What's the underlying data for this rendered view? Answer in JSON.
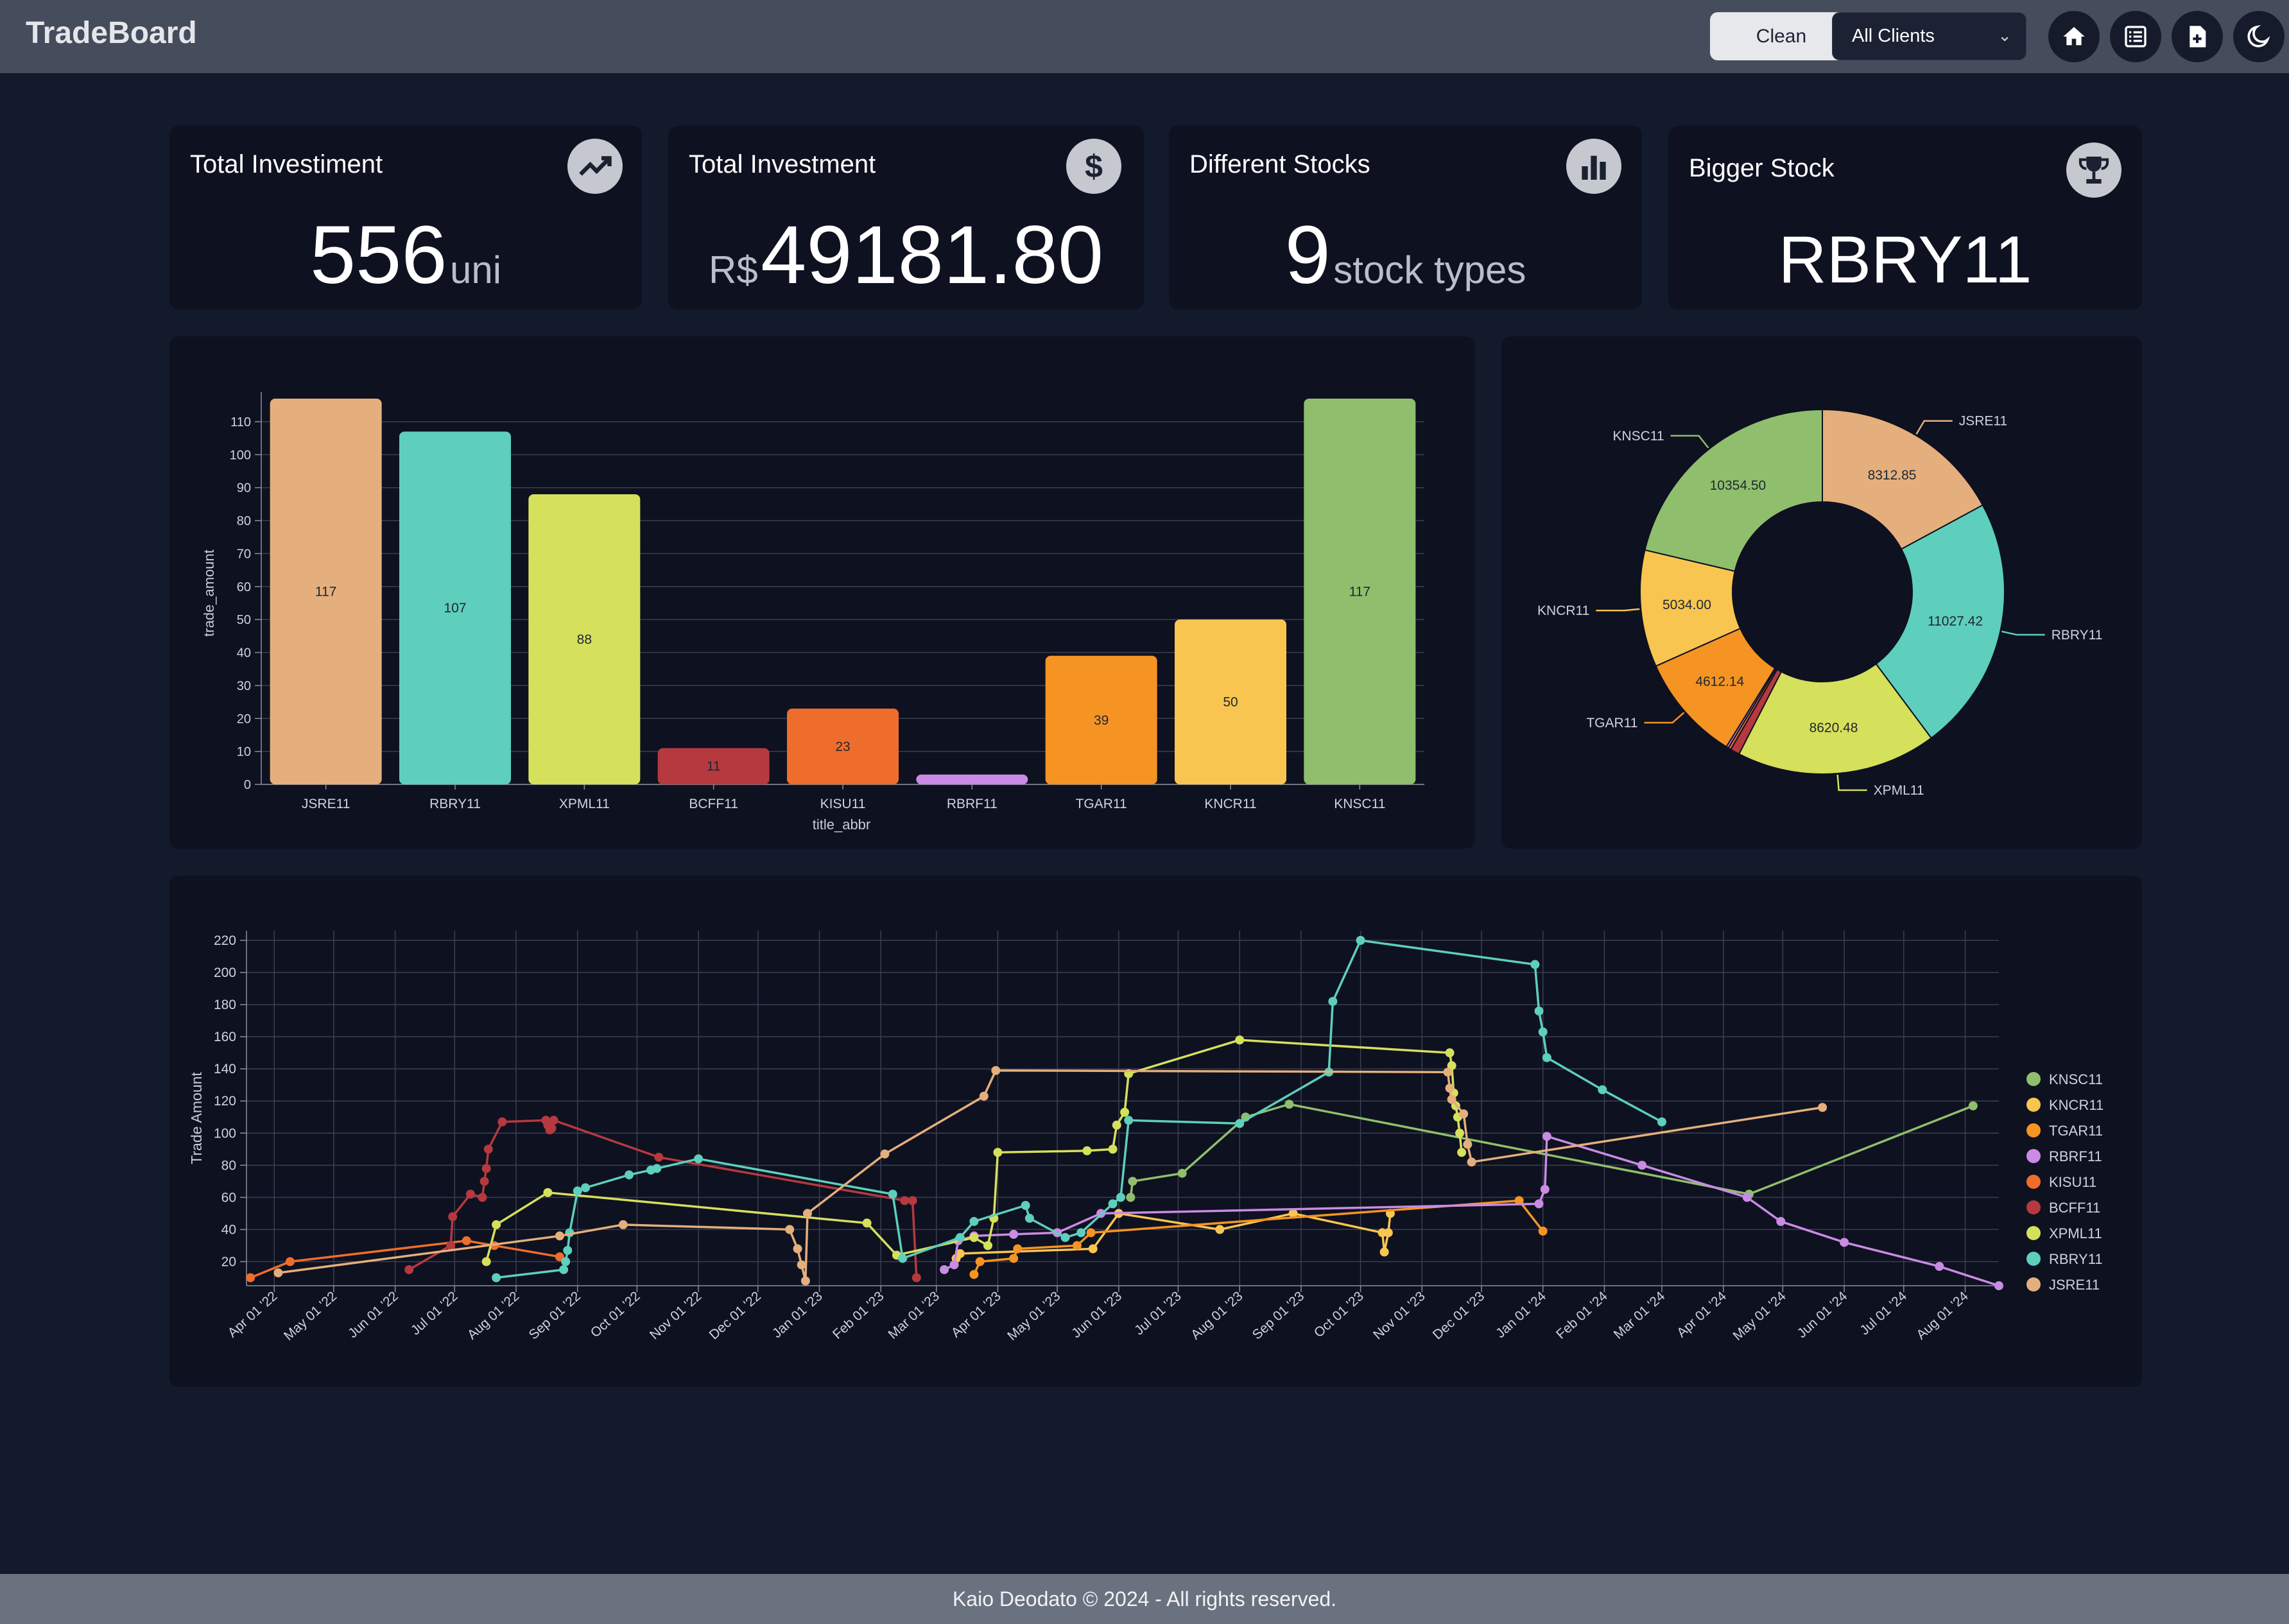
{
  "app": {
    "title": "TradeBoard"
  },
  "toolbar": {
    "clean_label": "Clean",
    "client_filter": "All Clients",
    "icons": [
      "home-icon",
      "list-icon",
      "add-file-icon",
      "moon-icon"
    ]
  },
  "kpis": [
    {
      "title": "Total Investiment",
      "prefix": "",
      "value": "556",
      "unit": "uni",
      "icon": "trend-icon"
    },
    {
      "title": "Total Investment",
      "prefix": "R$",
      "value": "49181.80",
      "unit": "",
      "icon": "dollar-icon"
    },
    {
      "title": "Different Stocks",
      "prefix": "",
      "value": "9",
      "unit": "stock types",
      "icon": "bar-chart-icon"
    },
    {
      "title": "Bigger Stock",
      "prefix": "",
      "value": "RBRY11",
      "unit": "",
      "icon": "trophy-icon"
    }
  ],
  "chart_data": [
    {
      "type": "bar",
      "xlabel": "title_abbr",
      "ylabel": "trade_amount",
      "ylim": [
        0,
        117
      ],
      "yticks": [
        0,
        10,
        20,
        30,
        40,
        50,
        60,
        70,
        80,
        90,
        100,
        110
      ],
      "categories": [
        "JSRE11",
        "RBRY11",
        "XPML11",
        "BCFF11",
        "KISU11",
        "RBRF11",
        "TGAR11",
        "KNCR11",
        "KNSC11"
      ],
      "values": [
        117,
        107,
        88,
        11,
        23,
        3,
        39,
        50,
        117
      ],
      "data_labels": [
        "117",
        "107",
        "88",
        "11",
        "23",
        "",
        "39",
        "50",
        "117"
      ],
      "colors": [
        "#e4af7c",
        "#5dcfbc",
        "#d5e05b",
        "#b5393f",
        "#ef6d2c",
        "#c98be4",
        "#f59423",
        "#f8c551",
        "#8fbf6c"
      ],
      "grid": true
    },
    {
      "type": "pie",
      "subtype": "donut",
      "slices": [
        {
          "label": "JSRE11",
          "value": 8312.85,
          "value_label": "8312.85",
          "color": "#e4af7c"
        },
        {
          "label": "RBRY11",
          "value": 11027.42,
          "value_label": "11027.42",
          "color": "#5dcfbc"
        },
        {
          "label": "XPML11",
          "value": 8620.48,
          "value_label": "8620.48",
          "color": "#d5e05b"
        },
        {
          "label": "BCFF11",
          "value": 400,
          "value_label": "",
          "color": "#b5393f"
        },
        {
          "label": "KISU11",
          "value": 120,
          "value_label": "",
          "color": "#ef6d2c"
        },
        {
          "label": "RBRF11",
          "value": 100,
          "value_label": "",
          "color": "#c98be4"
        },
        {
          "label": "TGAR11",
          "value": 4612.14,
          "value_label": "4612.14",
          "color": "#f59423"
        },
        {
          "label": "KNCR11",
          "value": 5034.0,
          "value_label": "5034.00",
          "color": "#f8c551"
        },
        {
          "label": "KNSC11",
          "value": 10354.5,
          "value_label": "10354.50",
          "color": "#8fbf6c"
        }
      ],
      "outer_labels": [
        "JSRE11",
        "RBRY11",
        "XPML11",
        "TGAR11",
        "KNCR11",
        "KNSC11"
      ]
    },
    {
      "type": "line",
      "ylabel": "Trade Amount",
      "xlabel": "",
      "ylim": [
        5,
        222
      ],
      "yticks": [
        20,
        40,
        60,
        80,
        100,
        120,
        140,
        160,
        180,
        200,
        220
      ],
      "xlim": [
        "2022-03-18",
        "2024-08-18"
      ],
      "xticks": [
        "Apr 01 '22",
        "May 01 '22",
        "Jun 01 '22",
        "Jul 01 '22",
        "Aug 01 '22",
        "Sep 01 '22",
        "Oct 01 '22",
        "Nov 01 '22",
        "Dec 01 '22",
        "Jan 01 '23",
        "Feb 01 '23",
        "Mar 01 '23",
        "Apr 01 '23",
        "May 01 '23",
        "Jun 01 '23",
        "Jul 01 '23",
        "Aug 01 '23",
        "Sep 01 '23",
        "Oct 01 '23",
        "Nov 01 '23",
        "Dec 01 '23",
        "Jan 01 '24",
        "Feb 01 '24",
        "Mar 01 '24",
        "Apr 01 '24",
        "May 01 '24",
        "Jun 01 '24",
        "Jul 01 '24",
        "Aug 01 '24"
      ],
      "legend_position": "right",
      "grid": true,
      "series": [
        {
          "name": "KNSC11",
          "color": "#8fbf6c",
          "points": [
            [
              "2023-06-07",
              60
            ],
            [
              "2023-06-08",
              70
            ],
            [
              "2023-07-03",
              75
            ],
            [
              "2023-08-04",
              110
            ],
            [
              "2023-08-26",
              118
            ],
            [
              "2024-04-14",
              62
            ],
            [
              "2024-08-05",
              117
            ]
          ]
        },
        {
          "name": "KNCR11",
          "color": "#f8c551",
          "points": [
            [
              "2023-03-11",
              22
            ],
            [
              "2023-03-13",
              25
            ],
            [
              "2023-05-19",
              28
            ],
            [
              "2023-06-01",
              50
            ],
            [
              "2023-07-22",
              40
            ],
            [
              "2023-08-28",
              50
            ],
            [
              "2023-10-12",
              38
            ],
            [
              "2023-10-13",
              26
            ],
            [
              "2023-10-15",
              38
            ],
            [
              "2023-10-16",
              50
            ]
          ]
        },
        {
          "name": "TGAR11",
          "color": "#f59423",
          "points": [
            [
              "2023-03-20",
              12
            ],
            [
              "2023-03-23",
              20
            ],
            [
              "2023-04-09",
              22
            ],
            [
              "2023-04-11",
              28
            ],
            [
              "2023-05-11",
              30
            ],
            [
              "2023-05-18",
              38
            ],
            [
              "2023-12-20",
              58
            ],
            [
              "2024-01-01",
              39
            ]
          ]
        },
        {
          "name": "RBRF11",
          "color": "#c98be4",
          "points": [
            [
              "2023-03-05",
              15
            ],
            [
              "2023-03-10",
              18
            ],
            [
              "2023-03-12",
              33
            ],
            [
              "2023-03-20",
              36
            ],
            [
              "2023-04-09",
              37
            ],
            [
              "2023-05-01",
              38
            ],
            [
              "2023-05-23",
              50
            ],
            [
              "2023-12-30",
              56
            ],
            [
              "2024-01-02",
              65
            ],
            [
              "2024-01-03",
              98
            ],
            [
              "2024-02-20",
              80
            ],
            [
              "2024-04-13",
              60
            ],
            [
              "2024-04-30",
              45
            ],
            [
              "2024-06-01",
              32
            ],
            [
              "2024-07-19",
              17
            ],
            [
              "2024-08-18",
              5
            ]
          ]
        },
        {
          "name": "KISU11",
          "color": "#ef6d2c",
          "points": [
            [
              "2022-03-20",
              10
            ],
            [
              "2022-04-09",
              20
            ],
            [
              "2022-07-07",
              33
            ],
            [
              "2022-07-21",
              30
            ],
            [
              "2022-08-23",
              23
            ]
          ]
        },
        {
          "name": "BCFF11",
          "color": "#b5393f",
          "points": [
            [
              "2022-06-08",
              15
            ],
            [
              "2022-06-29",
              30
            ],
            [
              "2022-06-30",
              48
            ],
            [
              "2022-07-09",
              62
            ],
            [
              "2022-07-15",
              60
            ],
            [
              "2022-07-16",
              70
            ],
            [
              "2022-07-17",
              78
            ],
            [
              "2022-07-18",
              90
            ],
            [
              "2022-07-25",
              107
            ],
            [
              "2022-08-16",
              108
            ],
            [
              "2022-08-17",
              105
            ],
            [
              "2022-08-18",
              102
            ],
            [
              "2022-08-19",
              103
            ],
            [
              "2022-08-20",
              108
            ],
            [
              "2022-10-12",
              85
            ],
            [
              "2023-02-13",
              58
            ],
            [
              "2023-02-17",
              58
            ],
            [
              "2023-02-19",
              10
            ]
          ]
        },
        {
          "name": "XPML11",
          "color": "#d5e05b",
          "points": [
            [
              "2022-07-17",
              20
            ],
            [
              "2022-07-22",
              43
            ],
            [
              "2022-08-17",
              63
            ],
            [
              "2023-01-25",
              44
            ],
            [
              "2023-02-09",
              24
            ],
            [
              "2023-03-20",
              35
            ],
            [
              "2023-03-27",
              30
            ],
            [
              "2023-03-30",
              47
            ],
            [
              "2023-04-01",
              88
            ],
            [
              "2023-05-16",
              89
            ],
            [
              "2023-05-29",
              90
            ],
            [
              "2023-05-31",
              105
            ],
            [
              "2023-06-04",
              113
            ],
            [
              "2023-06-06",
              137
            ],
            [
              "2023-08-01",
              158
            ],
            [
              "2023-11-15",
              150
            ],
            [
              "2023-11-16",
              142
            ],
            [
              "2023-11-17",
              125
            ],
            [
              "2023-11-18",
              117
            ],
            [
              "2023-11-19",
              110
            ],
            [
              "2023-11-20",
              100
            ],
            [
              "2023-11-21",
              88
            ]
          ]
        },
        {
          "name": "RBRY11",
          "color": "#5dcfbc",
          "points": [
            [
              "2022-07-22",
              10
            ],
            [
              "2022-08-25",
              15
            ],
            [
              "2022-08-26",
              20
            ],
            [
              "2022-08-27",
              27
            ],
            [
              "2022-08-28",
              38
            ],
            [
              "2022-09-01",
              64
            ],
            [
              "2022-09-05",
              66
            ],
            [
              "2022-09-27",
              74
            ],
            [
              "2022-10-08",
              77
            ],
            [
              "2022-10-11",
              78
            ],
            [
              "2022-11-01",
              84
            ],
            [
              "2023-02-07",
              62
            ],
            [
              "2023-02-12",
              22
            ],
            [
              "2023-03-13",
              35
            ],
            [
              "2023-03-20",
              45
            ],
            [
              "2023-04-15",
              55
            ],
            [
              "2023-04-17",
              47
            ],
            [
              "2023-05-05",
              35
            ],
            [
              "2023-05-13",
              38
            ],
            [
              "2023-05-29",
              56
            ],
            [
              "2023-06-02",
              60
            ],
            [
              "2023-06-06",
              108
            ],
            [
              "2023-08-01",
              106
            ],
            [
              "2023-09-15",
              138
            ],
            [
              "2023-09-17",
              182
            ],
            [
              "2023-10-01",
              220
            ],
            [
              "2023-12-28",
              205
            ],
            [
              "2023-12-30",
              176
            ],
            [
              "2024-01-01",
              163
            ],
            [
              "2024-01-03",
              147
            ],
            [
              "2024-01-31",
              127
            ],
            [
              "2024-03-01",
              107
            ]
          ]
        },
        {
          "name": "JSRE11",
          "color": "#e4af7c",
          "points": [
            [
              "2022-04-03",
              13
            ],
            [
              "2022-08-23",
              36
            ],
            [
              "2022-09-24",
              43
            ],
            [
              "2022-12-17",
              40
            ],
            [
              "2022-12-21",
              28
            ],
            [
              "2022-12-23",
              18
            ],
            [
              "2022-12-25",
              8
            ],
            [
              "2022-12-26",
              50
            ],
            [
              "2023-02-03",
              87
            ],
            [
              "2023-03-25",
              123
            ],
            [
              "2023-03-31",
              139
            ],
            [
              "2023-11-14",
              138
            ],
            [
              "2023-11-15",
              128
            ],
            [
              "2023-11-16",
              121
            ],
            [
              "2023-11-22",
              112
            ],
            [
              "2023-11-24",
              93
            ],
            [
              "2023-11-26",
              82
            ],
            [
              "2024-05-21",
              116
            ]
          ]
        }
      ]
    }
  ],
  "footer": {
    "text": "Kaio Deodato © 2024 - All rights reserved."
  }
}
